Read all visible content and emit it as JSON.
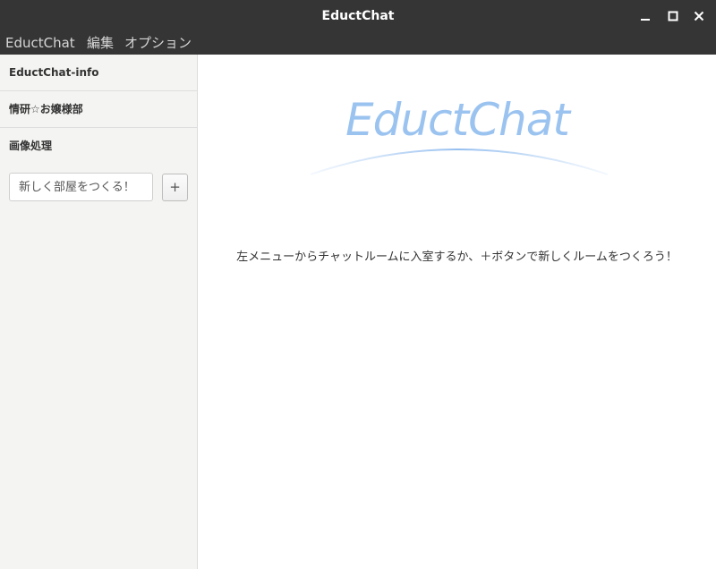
{
  "window": {
    "title": "EductChat",
    "controls": [
      "minimize-icon",
      "maximize-icon",
      "close-icon"
    ]
  },
  "menu": {
    "items": [
      "EductChat",
      "編集",
      "オプション"
    ]
  },
  "sidebar": {
    "rooms": [
      {
        "label": "EductChat-info"
      },
      {
        "label": "情研☆お嬢様部"
      },
      {
        "label": "画像処理"
      }
    ],
    "new_room_placeholder": "新しく部屋をつくる！",
    "add_button_label": "+"
  },
  "main": {
    "logo_text": "EductChat",
    "instructions": "左メニューからチャットルームに入室するか、＋ボタンで新しくルームをつくろう！"
  },
  "colors": {
    "titlebar": "#353535",
    "sidebar": "#f4f4f2",
    "logo": "#9bc3f0"
  }
}
